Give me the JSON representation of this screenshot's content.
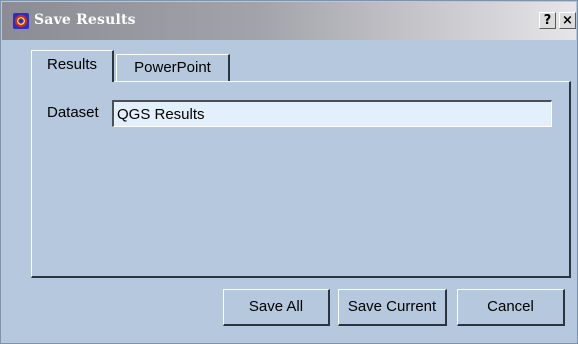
{
  "window": {
    "title": "Save Results",
    "icon": "app-logo-icon",
    "help_label": "?",
    "close_label": "×"
  },
  "tabs": [
    {
      "label": "Results",
      "selected": true
    },
    {
      "label": "PowerPoint",
      "selected": false
    }
  ],
  "results_tab": {
    "dataset_label": "Dataset",
    "dataset_value": "QGS Results"
  },
  "buttons": {
    "save_all": "Save All",
    "save_current": "Save Current",
    "cancel": "Cancel"
  },
  "colors": {
    "dialog_background": "#b6c8dd",
    "input_background": "#e3effa",
    "titlebar_gradient_start": "#8c8c94",
    "titlebar_gradient_end": "#e6e6e8"
  }
}
